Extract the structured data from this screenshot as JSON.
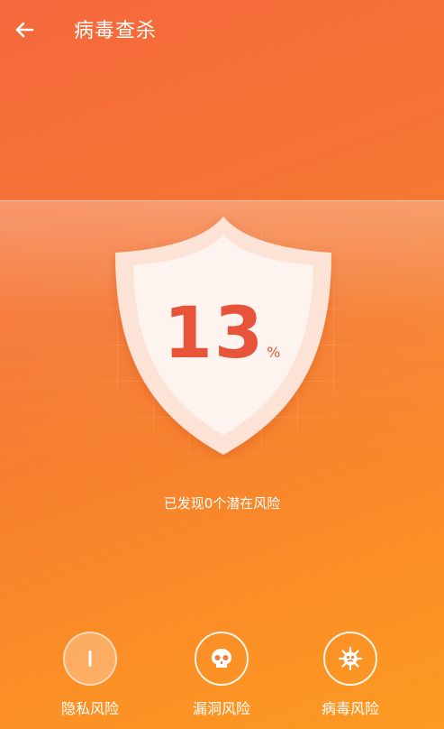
{
  "header": {
    "title": "病毒查杀"
  },
  "scan": {
    "percent": "13",
    "unit": "%"
  },
  "result": {
    "text": "已发现0个潜在风险"
  },
  "risks": [
    {
      "label": "隐私风险",
      "icon": "privacy-progress-icon"
    },
    {
      "label": "漏洞风险",
      "icon": "skull-icon"
    },
    {
      "label": "病毒风险",
      "icon": "virus-icon"
    }
  ],
  "colors": {
    "accent": "#e8543a",
    "bg_top": "#f5683c",
    "bg_bottom": "#fd9a22"
  }
}
